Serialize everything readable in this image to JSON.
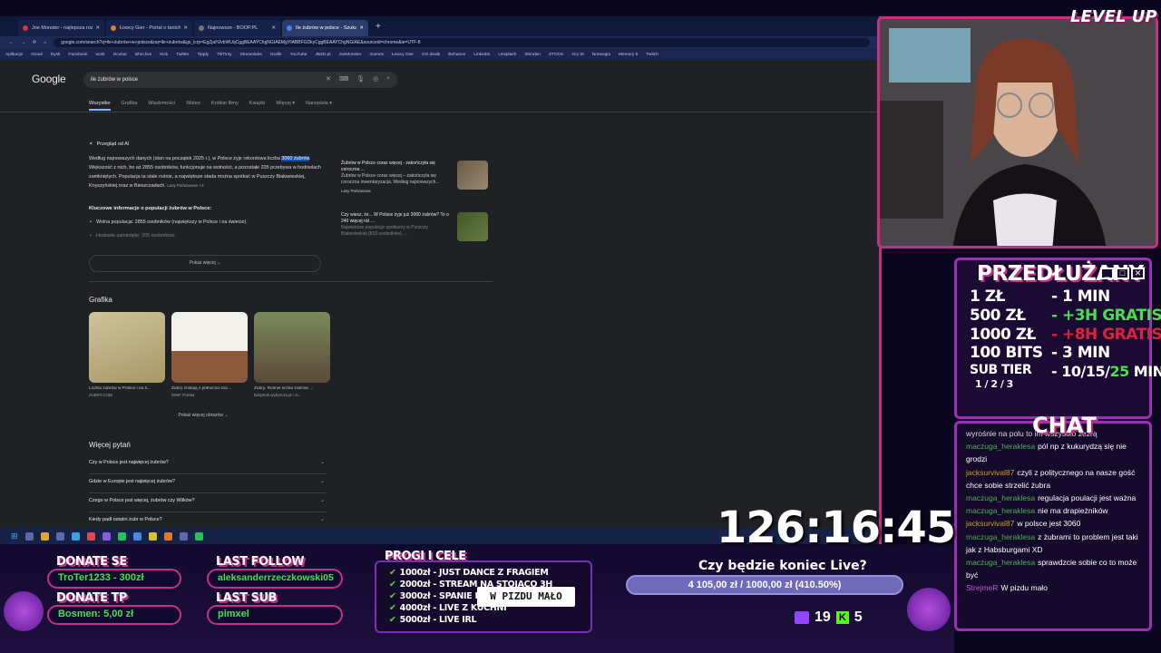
{
  "browser": {
    "tabs": [
      {
        "label": "Joe Monster - najlepsza rozryw..."
      },
      {
        "label": "Łowcy Gier - Portal o tanich gr..."
      },
      {
        "label": "Najnowsze - BOOP.PL"
      },
      {
        "label": "Ile żubrów w polsce - Szukaj w..."
      }
    ],
    "url": "google.com/search?q=ile+żubrów+w+polsce&oq=ile+żubrów&gs_lcrp=EgZjaHJvbWUqCggBEAAYChgNGIAEMgYIABBFGDkyCggBEAAYChgNGIAE&sourceid=chrome&ie=UTF-8",
    "bookmarks": [
      "Aplikacje",
      "Gmail",
      "Dysk",
      "Facebook",
      "work",
      "Oculus",
      "Ishin.live",
      "Kick",
      "Twitter",
      "Tipply",
      "TikTinty",
      "Streamlabs",
      "Grafik",
      "YouTube",
      "JBZD.pl",
      "JoeMonster",
      "Games",
      "Łowcy Gier",
      "GG.deals",
      "Behance",
      "LinkedIn",
      "Unsplash",
      "Shinden",
      "STOCK",
      "Gry trt",
      "Norwegia",
      "Memory 5",
      "Twitch"
    ]
  },
  "google": {
    "logo": "Google",
    "query": "ile żubrów w polsce",
    "tabs": [
      "Wszystko",
      "Grafika",
      "Wiadomości",
      "Wideo",
      "Krótkie filmy",
      "Książki",
      "Więcej ▾",
      "Narzędzia ▾"
    ],
    "ai_title": "Przegląd od AI",
    "ai_text_1": "Według najnowszych danych (stan na początek 2025 r.), w Polsce żyje rekordowa liczba ",
    "ai_highlight": "3060 żubrów",
    "ai_text_2": ". Większość z nich, bo aż 2855 osobników, funkcjonuje na wolności, a pozostałe 205 przebywa w hodowlach zamkniętych. Populacja ta stale rośnie, a największe stada można spotkać w Puszczy Białowieskiej, Knyszyńskiej oraz w Bieszczadach.",
    "ai_source": "Lasy Państwowe +3",
    "ai_heading": "Kluczowe informacje o populacji żubrów w Polsce:",
    "ai_items": [
      "Wolna populacja: 2855 osobników (największy w Polsce i na świecie).",
      "Hodowle zamknięte: 205 osobników."
    ],
    "ai_cards": [
      {
        "title": "Żubrów w Polsce coraz więcej - zakończyła się coroczna ...",
        "text": "Żubrów w Polsce coraz więcej – zakończyła się coroczna inwentaryzacja. Według najnowszych...",
        "source": "Lasy Państwowe"
      },
      {
        "title": "Czy wiesz, że... W Polsce żyje już 3060 żubrów? To o 240 więcej niż ...",
        "text": "Największe populacje spotkamy w Puszczy Białowieskiej (810 osobników), ..."
      }
    ],
    "show_more": "Pokaż więcej ⌄",
    "images_heading": "Grafika",
    "images": [
      {
        "caption": "Liczba żubrów w Polsce i na ś...",
        "source": "ZUBRY.COM"
      },
      {
        "caption": "Żubry znikają z północno-zac...",
        "source": "WWF Polska"
      },
      {
        "caption": "Żubry. Rośnie liczba żubrów ...",
        "source": "bialystok.wyborcza.pl › G..."
      }
    ],
    "more_images": "Pokaż więcej obrazów ⌄",
    "paa_heading": "Więcej pytań",
    "paa": [
      "Czy w Polsce jest najwięcej żubrów?",
      "Gdzie w Europie jest najwięcej żubrów?",
      "Czego w Polsce jest więcej, żubrów czy Wilków?",
      "Kiedy padł ostatni żubr w Polsce?"
    ],
    "feedback": "Przekaż opinię"
  },
  "overlay": {
    "brand": "LEVEL UP",
    "price_title": "PRZEDŁUŻANY",
    "price_rows": [
      {
        "k": "1 ZŁ",
        "v": "- 1 MIN",
        "c": "white"
      },
      {
        "k": "500 ZŁ",
        "v": "- +3H GRATIS",
        "c": "green"
      },
      {
        "k": "1000 ZŁ",
        "v": "- +8H GRATIS",
        "c": "red"
      },
      {
        "k": "100 BITS",
        "v": "- 3 MIN",
        "c": "white"
      }
    ],
    "sub_tier": "SUB TIER",
    "sub_tiers": "1 / 2 / 3",
    "sub_value": "- 10/15/",
    "sub_value_green": "25",
    "sub_min": " MIN",
    "chat_title": "CHAT",
    "chat": [
      {
        "user": "",
        "text": "wyrośnie na polu to im wszystko zeżrą"
      },
      {
        "user": "maczuga_heraklesa",
        "text": "pól np z kukurydzą się nie grodzi"
      },
      {
        "user": "jacksurvival87",
        "text": "czyli z politycznego na nasze gość chce sobie strzelić żubra",
        "cls": "y"
      },
      {
        "user": "maczuga_heraklesa",
        "text": "regulacja poulacji jest ważna"
      },
      {
        "user": "maczuga_heraklesa",
        "text": "nie ma drapieżników"
      },
      {
        "user": "jacksurvival87",
        "text": "w polsce jest 3060",
        "cls": "y"
      },
      {
        "user": "maczuga_heraklesa",
        "text": "z żubrami to problem jest taki jak z Habsburgami XD"
      },
      {
        "user": "maczuga_heraklesa",
        "text": "sprawdzcie sobie co to może być"
      },
      {
        "user": "StrejmeR",
        "text": "W pizdu mało",
        "cls": "m"
      }
    ],
    "timer": "126:16:45",
    "donate_se_label": "DONATE SE",
    "donate_se_value": "TroTer1233 - 300zł",
    "donate_tp_label": "DONATE TP",
    "donate_tp_value": "Bosmen: 5,00 zł",
    "last_follow_label": "LAST FOLLOW",
    "last_follow_value": "aleksanderrzeczkowski05",
    "last_sub_label": "LAST SUB",
    "last_sub_value": "pimxel",
    "goals_title": "PROGI I CELE",
    "goals": [
      "1000zł - JUST DANCE Z FRAGIEM",
      "2000zł - STREAM NA STOJĄCO 3H",
      "3000zł - SPANIE NA STREAMIE",
      "4000zł - LIVE Z KUCHNI",
      "5000zł - LIVE IRL"
    ],
    "alert": "W PIZDU MAŁO",
    "end_question": "Czy będzie koniec Live?",
    "end_progress": "4 105,00 zł / 1000,00 zł (410.50%)",
    "twitch_count": "19",
    "kick_count": "5"
  }
}
